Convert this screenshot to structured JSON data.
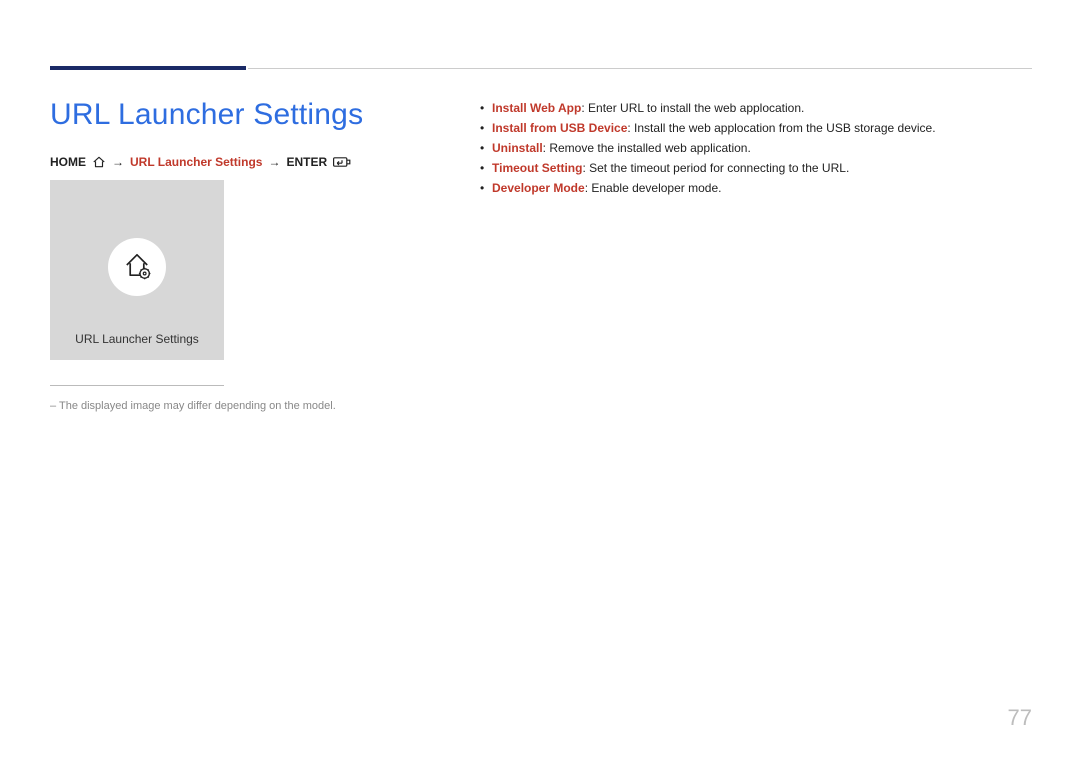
{
  "title": "URL Launcher Settings",
  "breadcrumb": {
    "home": "HOME",
    "current": "URL Launcher Settings",
    "enter": "ENTER",
    "arrow": "→"
  },
  "thumbnail": {
    "label": "URL Launcher Settings",
    "icon_name": "home-gear-icon"
  },
  "image_note": "The displayed image may differ depending on the model.",
  "features": [
    {
      "term": "Install Web App",
      "desc": "Enter URL to install the web applocation."
    },
    {
      "term": "Install from USB Device",
      "desc": "Install the web applocation from the USB storage device."
    },
    {
      "term": "Uninstall",
      "desc": "Remove the installed web application."
    },
    {
      "term": "Timeout Setting",
      "desc": "Set the timeout period for connecting to the URL."
    },
    {
      "term": "Developer Mode",
      "desc": "Enable developer mode."
    }
  ],
  "page_number": "77"
}
